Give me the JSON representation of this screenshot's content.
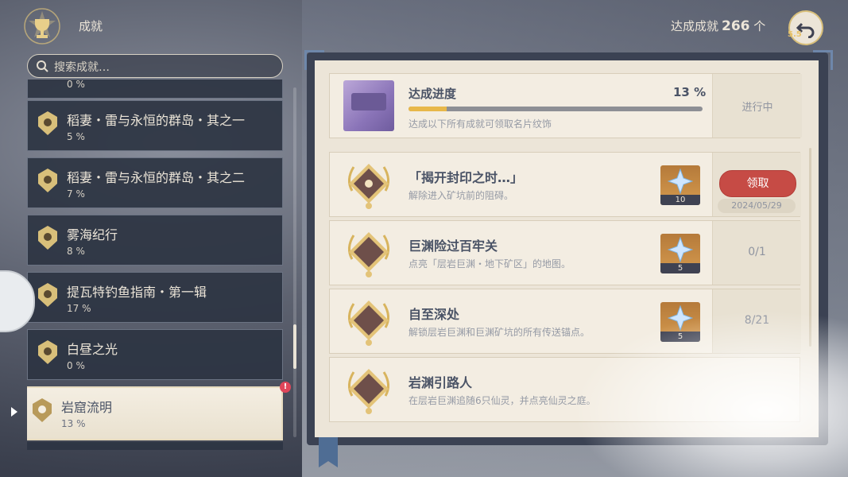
{
  "header": {
    "title": "成就",
    "total_label": "达成成就",
    "total_count": "266",
    "total_unit": "个",
    "back_sub": "5.5"
  },
  "search": {
    "placeholder": "搜索成就…"
  },
  "categories": [
    {
      "name": "",
      "percent": "0 %"
    },
    {
      "name": "稻妻・雷与永恒的群岛・其之一",
      "percent": "5 %"
    },
    {
      "name": "稻妻・雷与永恒的群岛・其之二",
      "percent": "7 %"
    },
    {
      "name": "雾海纪行",
      "percent": "8 %"
    },
    {
      "name": "提瓦特钓鱼指南・第一辑",
      "percent": "17 %"
    },
    {
      "name": "白昼之光",
      "percent": "0 %"
    },
    {
      "name": "岩窟流明",
      "percent": "13 %",
      "selected": true
    }
  ],
  "notification_badge": "!",
  "progress": {
    "title": "达成进度",
    "percent_text": "13 %",
    "percent": 13,
    "description": "达成以下所有成就可领取名片纹饰",
    "status": "进行中"
  },
  "achievements": [
    {
      "name": "「揭开封印之时…」",
      "description": "解除进入矿坑前的阻碍。",
      "reward_qty": "10",
      "claim_label": "领取",
      "date": "2024/05/29",
      "count": ""
    },
    {
      "name": "巨渊险过百牢关",
      "description": "点亮「层岩巨渊・地下矿区」的地图。",
      "reward_qty": "5",
      "count": "0/1"
    },
    {
      "name": "自至深处",
      "description": "解锁层岩巨渊和巨渊矿坑的所有传送锚点。",
      "reward_qty": "5",
      "count": "8/21"
    },
    {
      "name": "岩渊引路人",
      "description": "在层岩巨渊追随6只仙灵，并点亮仙灵之庭。",
      "reward_qty": "",
      "count": ""
    }
  ],
  "colors": {
    "accent_gold": "#e8b84a",
    "claim_red": "#c64b45",
    "panel_bg": "#ece5d8",
    "text_dark": "#4a5366"
  },
  "icons": {
    "logo": "trophy-emblem-icon",
    "back": "return-arrow-icon",
    "search": "search-icon",
    "reward": "primogem-icon",
    "medal": "achievement-medal-icon"
  }
}
